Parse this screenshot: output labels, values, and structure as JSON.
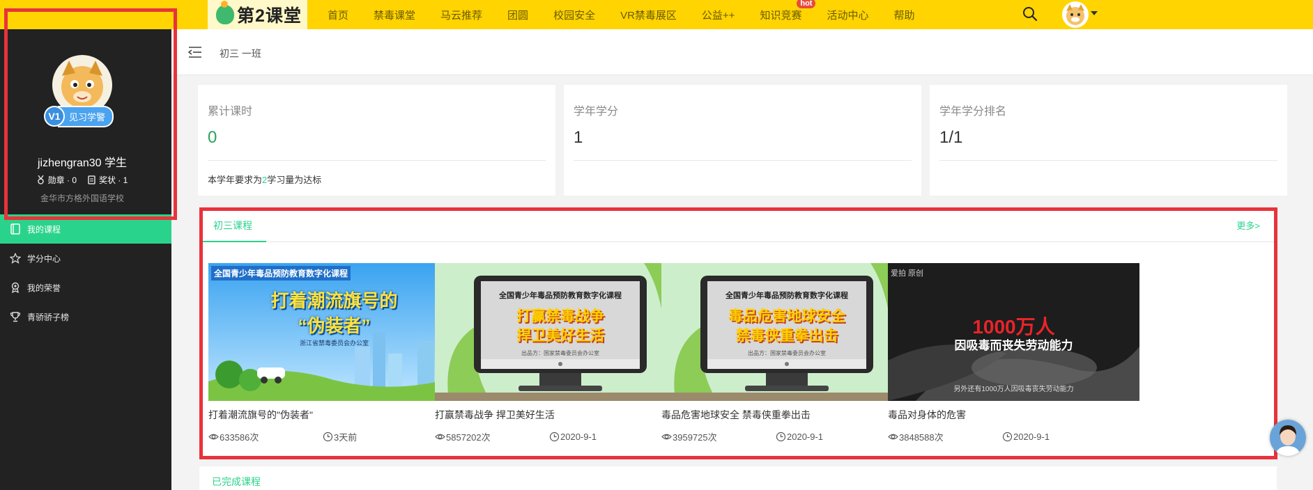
{
  "app": {
    "logo_text": "第2课堂"
  },
  "nav": {
    "items": [
      "首页",
      "禁毒课堂",
      "马云推荐",
      "团圆",
      "校园安全",
      "VR禁毒展区",
      "公益++",
      "知识竞赛",
      "活动中心",
      "帮助"
    ],
    "hot_badge": "hot",
    "hot_item_index": 7
  },
  "sidebar": {
    "level_number": "V1",
    "level_name": "见习学警",
    "username": "jizhengran30 学生",
    "medals": "勋章 · 0",
    "awards": "奖状 · 1",
    "school": "金华市方格外国语学校",
    "menu": [
      {
        "label": "我的课程",
        "icon": "book-icon",
        "active": true
      },
      {
        "label": "学分中心",
        "icon": "star-icon",
        "active": false
      },
      {
        "label": "我的荣誉",
        "icon": "medal-icon",
        "active": false
      },
      {
        "label": "青骄骄子榜",
        "icon": "trophy-icon",
        "active": false
      }
    ]
  },
  "breadcrumb": {
    "current": "初三 一班"
  },
  "stats": {
    "hours_label": "累计课时",
    "hours_value": "0",
    "hours_note_prefix": "本学年要求为",
    "hours_note_num": "2",
    "hours_note_suffix": "学习量为达标",
    "credits_label": "学年学分",
    "credits_value": "1",
    "rank_label": "学年学分排名",
    "rank_value": "1/1"
  },
  "courses": {
    "tab": "初三课程",
    "more": "更多>",
    "items": [
      {
        "title": "打着潮流旗号的\"伪装者\"",
        "views": "633586次",
        "date": "3天前",
        "thumb_header": "全国青少年毒品预防教育数字化课程",
        "thumb_line1": "打着潮流旗号的",
        "thumb_line2": "“伪装者”",
        "thumb_footer": "浙江省禁毒委员会办公室"
      },
      {
        "title": "打赢禁毒战争 捍卫美好生活",
        "views": "5857202次",
        "date": "2020-9-1",
        "thumb_header": "全国青少年毒品预防教育数字化课程",
        "thumb_line1": "打赢禁毒战争",
        "thumb_line2": "捍卫美好生活",
        "thumb_footer": "出品方：国家禁毒委员会办公室"
      },
      {
        "title": "毒品危害地球安全 禁毒侠重拳出击",
        "views": "3959725次",
        "date": "2020-9-1",
        "thumb_header": "全国青少年毒品预防教育数字化课程",
        "thumb_line1": "毒品危害地球安全",
        "thumb_line2": "禁毒侠重拳出击",
        "thumb_footer": "出品方：国家禁毒委员会办公室"
      },
      {
        "title": "毒品对身体的危害",
        "views": "3848588次",
        "date": "2020-9-1",
        "thumb_header": "爱拍 原创",
        "thumb_line1": "1000万人",
        "thumb_line2": "因吸毒而丧失劳动能力",
        "thumb_footer": "另外还有1000万人因吸毒丧失劳动能力"
      }
    ]
  },
  "completed": {
    "tab": "已完成课程"
  },
  "colors": {
    "topbar": "#ffd400",
    "sidebar": "#222222",
    "accent_green": "#2ad38b",
    "highlight_red": "#e8333b"
  }
}
